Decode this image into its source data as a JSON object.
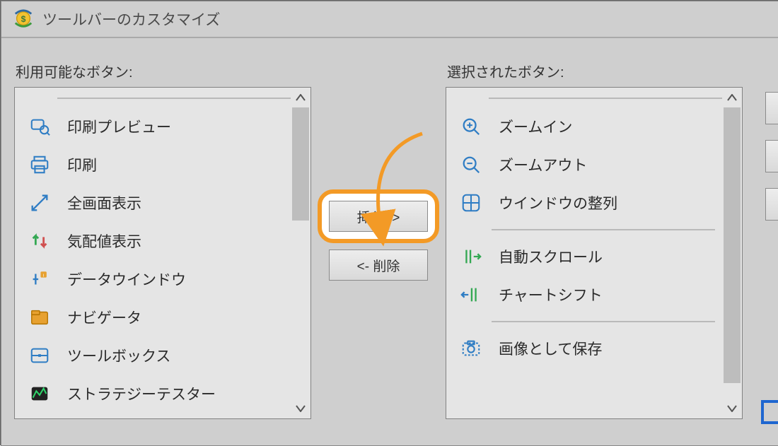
{
  "title": "ツールバーのカスタマイズ",
  "left_label": "利用可能なボタン:",
  "right_label": "選択されたボタン:",
  "insert_label": "挿入 ->",
  "remove_label": "<- 削除",
  "available": [
    {
      "icon": "preview-icon",
      "label": "印刷プレビュー"
    },
    {
      "icon": "print-icon",
      "label": "印刷"
    },
    {
      "icon": "fullscreen-icon",
      "label": "全画面表示"
    },
    {
      "icon": "market-watch-icon",
      "label": "気配値表示"
    },
    {
      "icon": "data-window-icon",
      "label": "データウインドウ"
    },
    {
      "icon": "navigator-icon",
      "label": "ナビゲータ"
    },
    {
      "icon": "toolbox-icon",
      "label": "ツールボックス"
    },
    {
      "icon": "strategy-tester-icon",
      "label": "ストラテジーテスター"
    }
  ],
  "selected": [
    {
      "icon": "zoom-in-icon",
      "label": "ズームイン"
    },
    {
      "icon": "zoom-out-icon",
      "label": "ズームアウト"
    },
    {
      "icon": "tile-windows-icon",
      "label": "ウインドウの整列"
    },
    {
      "sep": true
    },
    {
      "icon": "auto-scroll-icon",
      "label": "自動スクロール"
    },
    {
      "icon": "chart-shift-icon",
      "label": "チャートシフト"
    },
    {
      "sep": true
    },
    {
      "icon": "save-image-icon",
      "label": "画像として保存"
    }
  ]
}
